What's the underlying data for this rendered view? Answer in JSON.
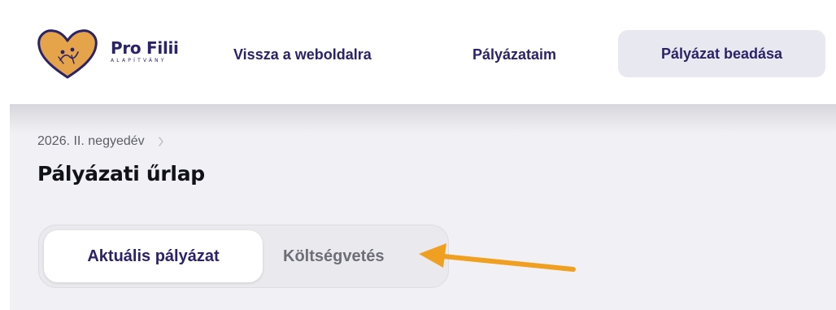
{
  "header": {
    "logo": {
      "name": "Pro Filii",
      "subtitle": "ALAPÍTVÁNY"
    },
    "nav": {
      "back_label": "Vissza a weboldalra",
      "mine_label": "Pályázataim",
      "submit_label": "Pályázat beadása"
    }
  },
  "main": {
    "breadcrumb": {
      "item": "2026. II. negyedév"
    },
    "title": "Pályázati űrlap",
    "tabs": [
      {
        "label": "Aktuális pályázat",
        "active": true
      },
      {
        "label": "Költségvetés",
        "active": false
      }
    ]
  },
  "colors": {
    "brand": "#2b2368",
    "logo_heart": "#e6a44a",
    "nav_submit_bg": "#e8e8f0",
    "content_bg": "#f1f1f5",
    "annotation_arrow": "#f0a020"
  },
  "icons": {
    "breadcrumb_separator": "chevron-right-icon",
    "annotation": "arrow-left-icon"
  }
}
